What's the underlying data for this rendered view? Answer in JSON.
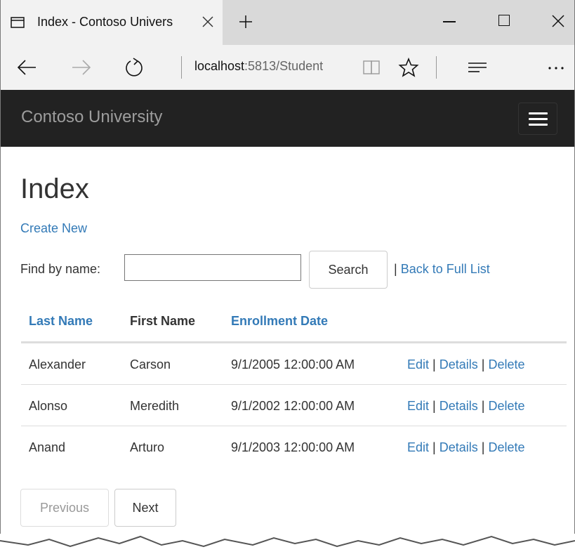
{
  "browser": {
    "tab_title": "Index - Contoso Univers",
    "url_host": "localhost",
    "url_rest": ":5813/Student"
  },
  "site": {
    "brand": "Contoso University"
  },
  "page": {
    "heading": "Index",
    "create_new": "Create New",
    "find_label": "Find by name:",
    "search_value": "",
    "search_button": "Search",
    "separator": "|",
    "back_to_full_list": "Back to Full List"
  },
  "table": {
    "headers": {
      "last_name": "Last Name",
      "first_name": "First Name",
      "enrollment_date": "Enrollment Date"
    },
    "rows": [
      {
        "last": "Alexander",
        "first": "Carson",
        "date": "9/1/2005 12:00:00 AM"
      },
      {
        "last": "Alonso",
        "first": "Meredith",
        "date": "9/1/2002 12:00:00 AM"
      },
      {
        "last": "Anand",
        "first": "Arturo",
        "date": "9/1/2003 12:00:00 AM"
      }
    ],
    "actions": {
      "edit": "Edit",
      "details": "Details",
      "delete": "Delete",
      "sep": "|"
    }
  },
  "pager": {
    "previous": "Previous",
    "next": "Next",
    "previous_disabled": true
  },
  "colors": {
    "link": "#337ab7",
    "navbar_bg": "#222222",
    "brand": "#9d9d9d"
  },
  "icons": {
    "tab": "tab-page-icon",
    "close": "close-icon",
    "new_tab": "plus-icon",
    "back": "back-arrow-icon",
    "forward": "forward-arrow-icon",
    "refresh": "refresh-icon",
    "reading_view": "reading-view-icon",
    "favorite": "star-icon",
    "hub": "hub-icon",
    "more": "more-icon",
    "menu": "hamburger-icon"
  }
}
